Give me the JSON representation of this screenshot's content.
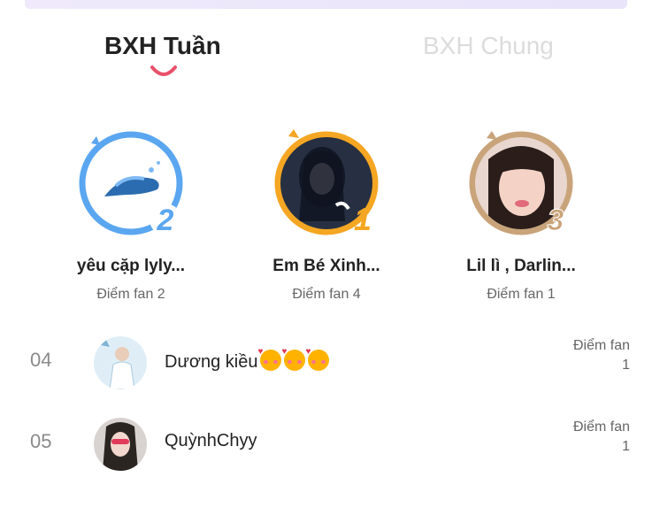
{
  "tabs": [
    {
      "label": "BXH Tuần",
      "active": true
    },
    {
      "label": "BXH Chung",
      "active": false
    }
  ],
  "colors": {
    "accent": "#e8516b",
    "gold": "#f5a623",
    "blue": "#5aa6f0",
    "bronze": "#c9a47a"
  },
  "podium": [
    {
      "rank": "2",
      "name": "yêu cặp lyly...",
      "score": "Điểm fan 2",
      "ring": "blue",
      "avatar_icon": "whale-icon"
    },
    {
      "rank": "1",
      "name": "Em Bé Xinh...",
      "score": "Điểm fan 4",
      "ring": "gold",
      "avatar_icon": "anime-girl-icon"
    },
    {
      "rank": "3",
      "name": "Lil lì , Darlin...",
      "score": "Điểm fan 1",
      "ring": "bronze",
      "avatar_icon": "girl-photo-icon"
    }
  ],
  "list": [
    {
      "rank": "04",
      "name": "Dương kiều",
      "emoji_count": 3,
      "score_label": "Điểm fan",
      "score_value": "1"
    },
    {
      "rank": "05",
      "name": "QuỳnhChyy",
      "score_label": "Điểm fan",
      "score_value": "1"
    }
  ]
}
